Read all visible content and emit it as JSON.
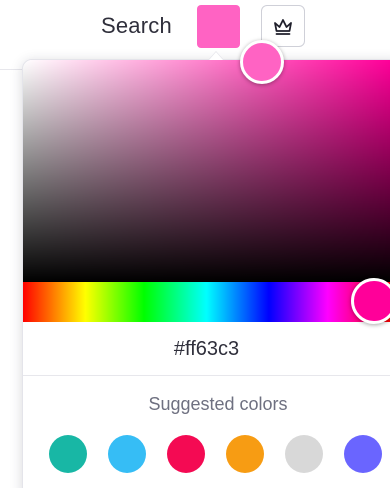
{
  "header": {
    "search_label": "Search",
    "selected_color": "#ff63c3",
    "crown_icon": "crown-icon"
  },
  "picker": {
    "hex_value": "#ff63c3",
    "hue_color": "#ff0099",
    "suggested_label": "Suggested colors",
    "suggested_colors": [
      "#18b7a5",
      "#36bdf5",
      "#f40a53",
      "#f79c13",
      "#d8d8d8",
      "#6a65ff"
    ]
  }
}
